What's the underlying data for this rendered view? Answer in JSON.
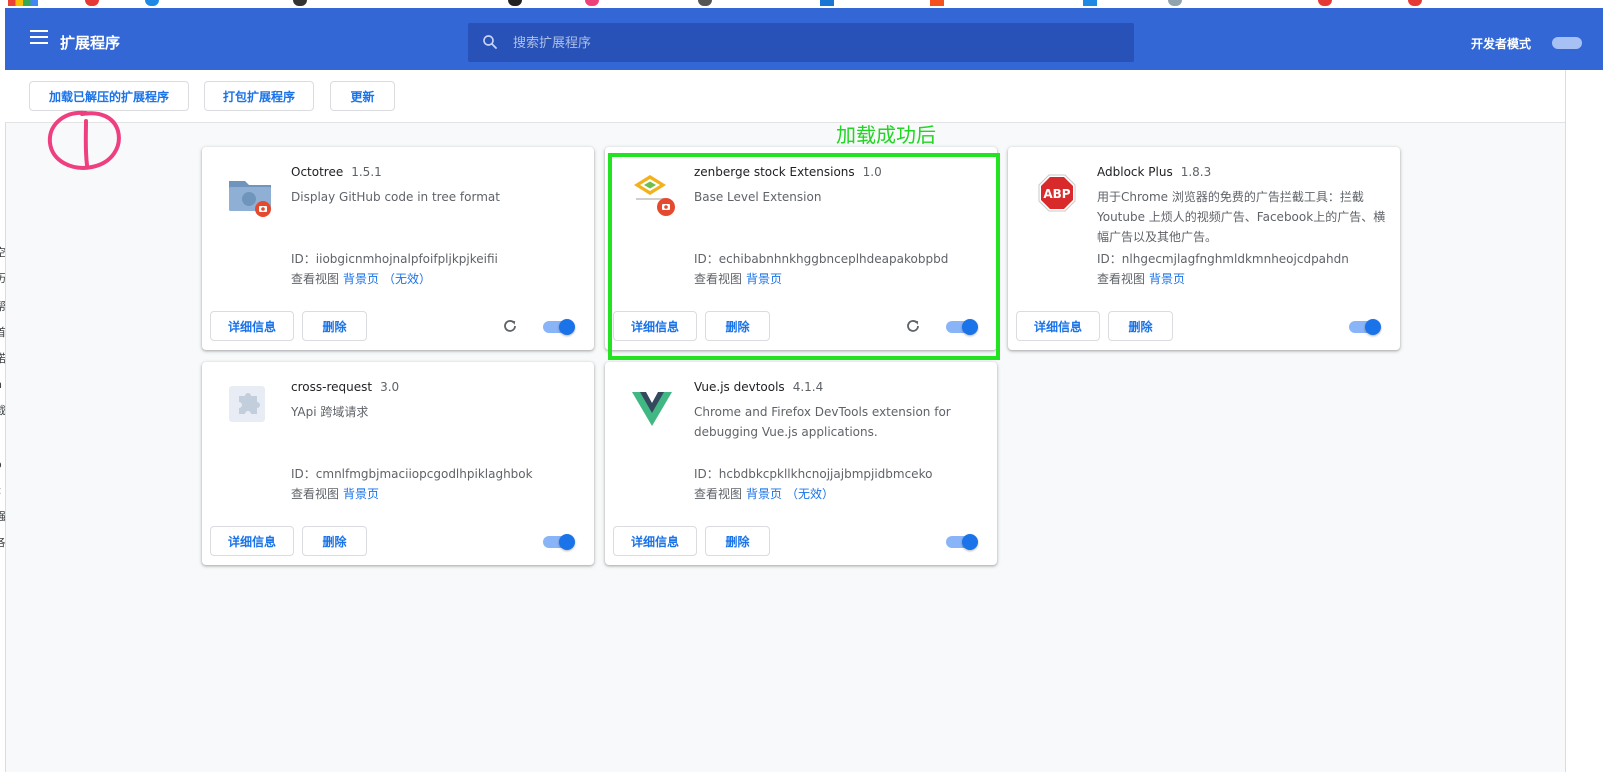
{
  "header": {
    "title": "扩展程序",
    "search_placeholder": "搜索扩展程序",
    "devmode_label": "开发者模式"
  },
  "toolbar": {
    "load_unpacked": "加载已解压的扩展程序",
    "pack": "打包扩展程序",
    "update": "更新"
  },
  "annotation": {
    "text": "加载成功后",
    "highlight_color": "#22e222",
    "circle_mark": "①"
  },
  "common": {
    "details": "详细信息",
    "remove": "删除",
    "inspect_views": "查看视图",
    "background_page": "背景页",
    "inactive": "（无效）",
    "id_prefix": "ID："
  },
  "extensions": [
    {
      "name": "Octotree",
      "version": "1.5.1",
      "description": "Display GitHub code in tree format",
      "id": "iiobgicnmhojnalpfoifpljkpjkeifii",
      "icon": "octotree-folder-icon",
      "enabled": true
    },
    {
      "name": "zenberge stock Extensions",
      "version": "1.0",
      "description": "Base Level Extension",
      "id": "echibabnhnkhggbnceplhdeapakobpbd",
      "icon": "zenberge-logo-icon",
      "enabled": true
    },
    {
      "name": "Adblock Plus",
      "version": "1.8.3",
      "description": "用于Chrome 浏览器的免费的广告拦截工具：拦截 Youtube 上烦人的视频广告、Facebook上的广告、横幅广告以及其他广告。",
      "id": "nlhgecmjlagfnghmldkmnheojcdpahdn",
      "icon": "abp-stop-sign-icon",
      "enabled": true
    },
    {
      "name": "cross-request",
      "version": "3.0",
      "description": "YApi 跨域请求",
      "id": "cmnlfmgbjmaciiopcgodlhpiklaghbok",
      "icon": "puzzle-piece-icon",
      "enabled": true
    },
    {
      "name": "Vue.js devtools",
      "version": "4.1.4",
      "description": "Chrome and Firefox DevTools extension for debugging Vue.js applications.",
      "id": "hcbdbkcpkllkhcnojjajbmpjidbmceko",
      "icon": "vue-logo-icon",
      "enabled": true
    }
  ],
  "colors": {
    "header_bg": "#3367d6",
    "accent": "#1a73e8",
    "highlight": "#22e222",
    "circle_mark": "#ee4080"
  }
}
